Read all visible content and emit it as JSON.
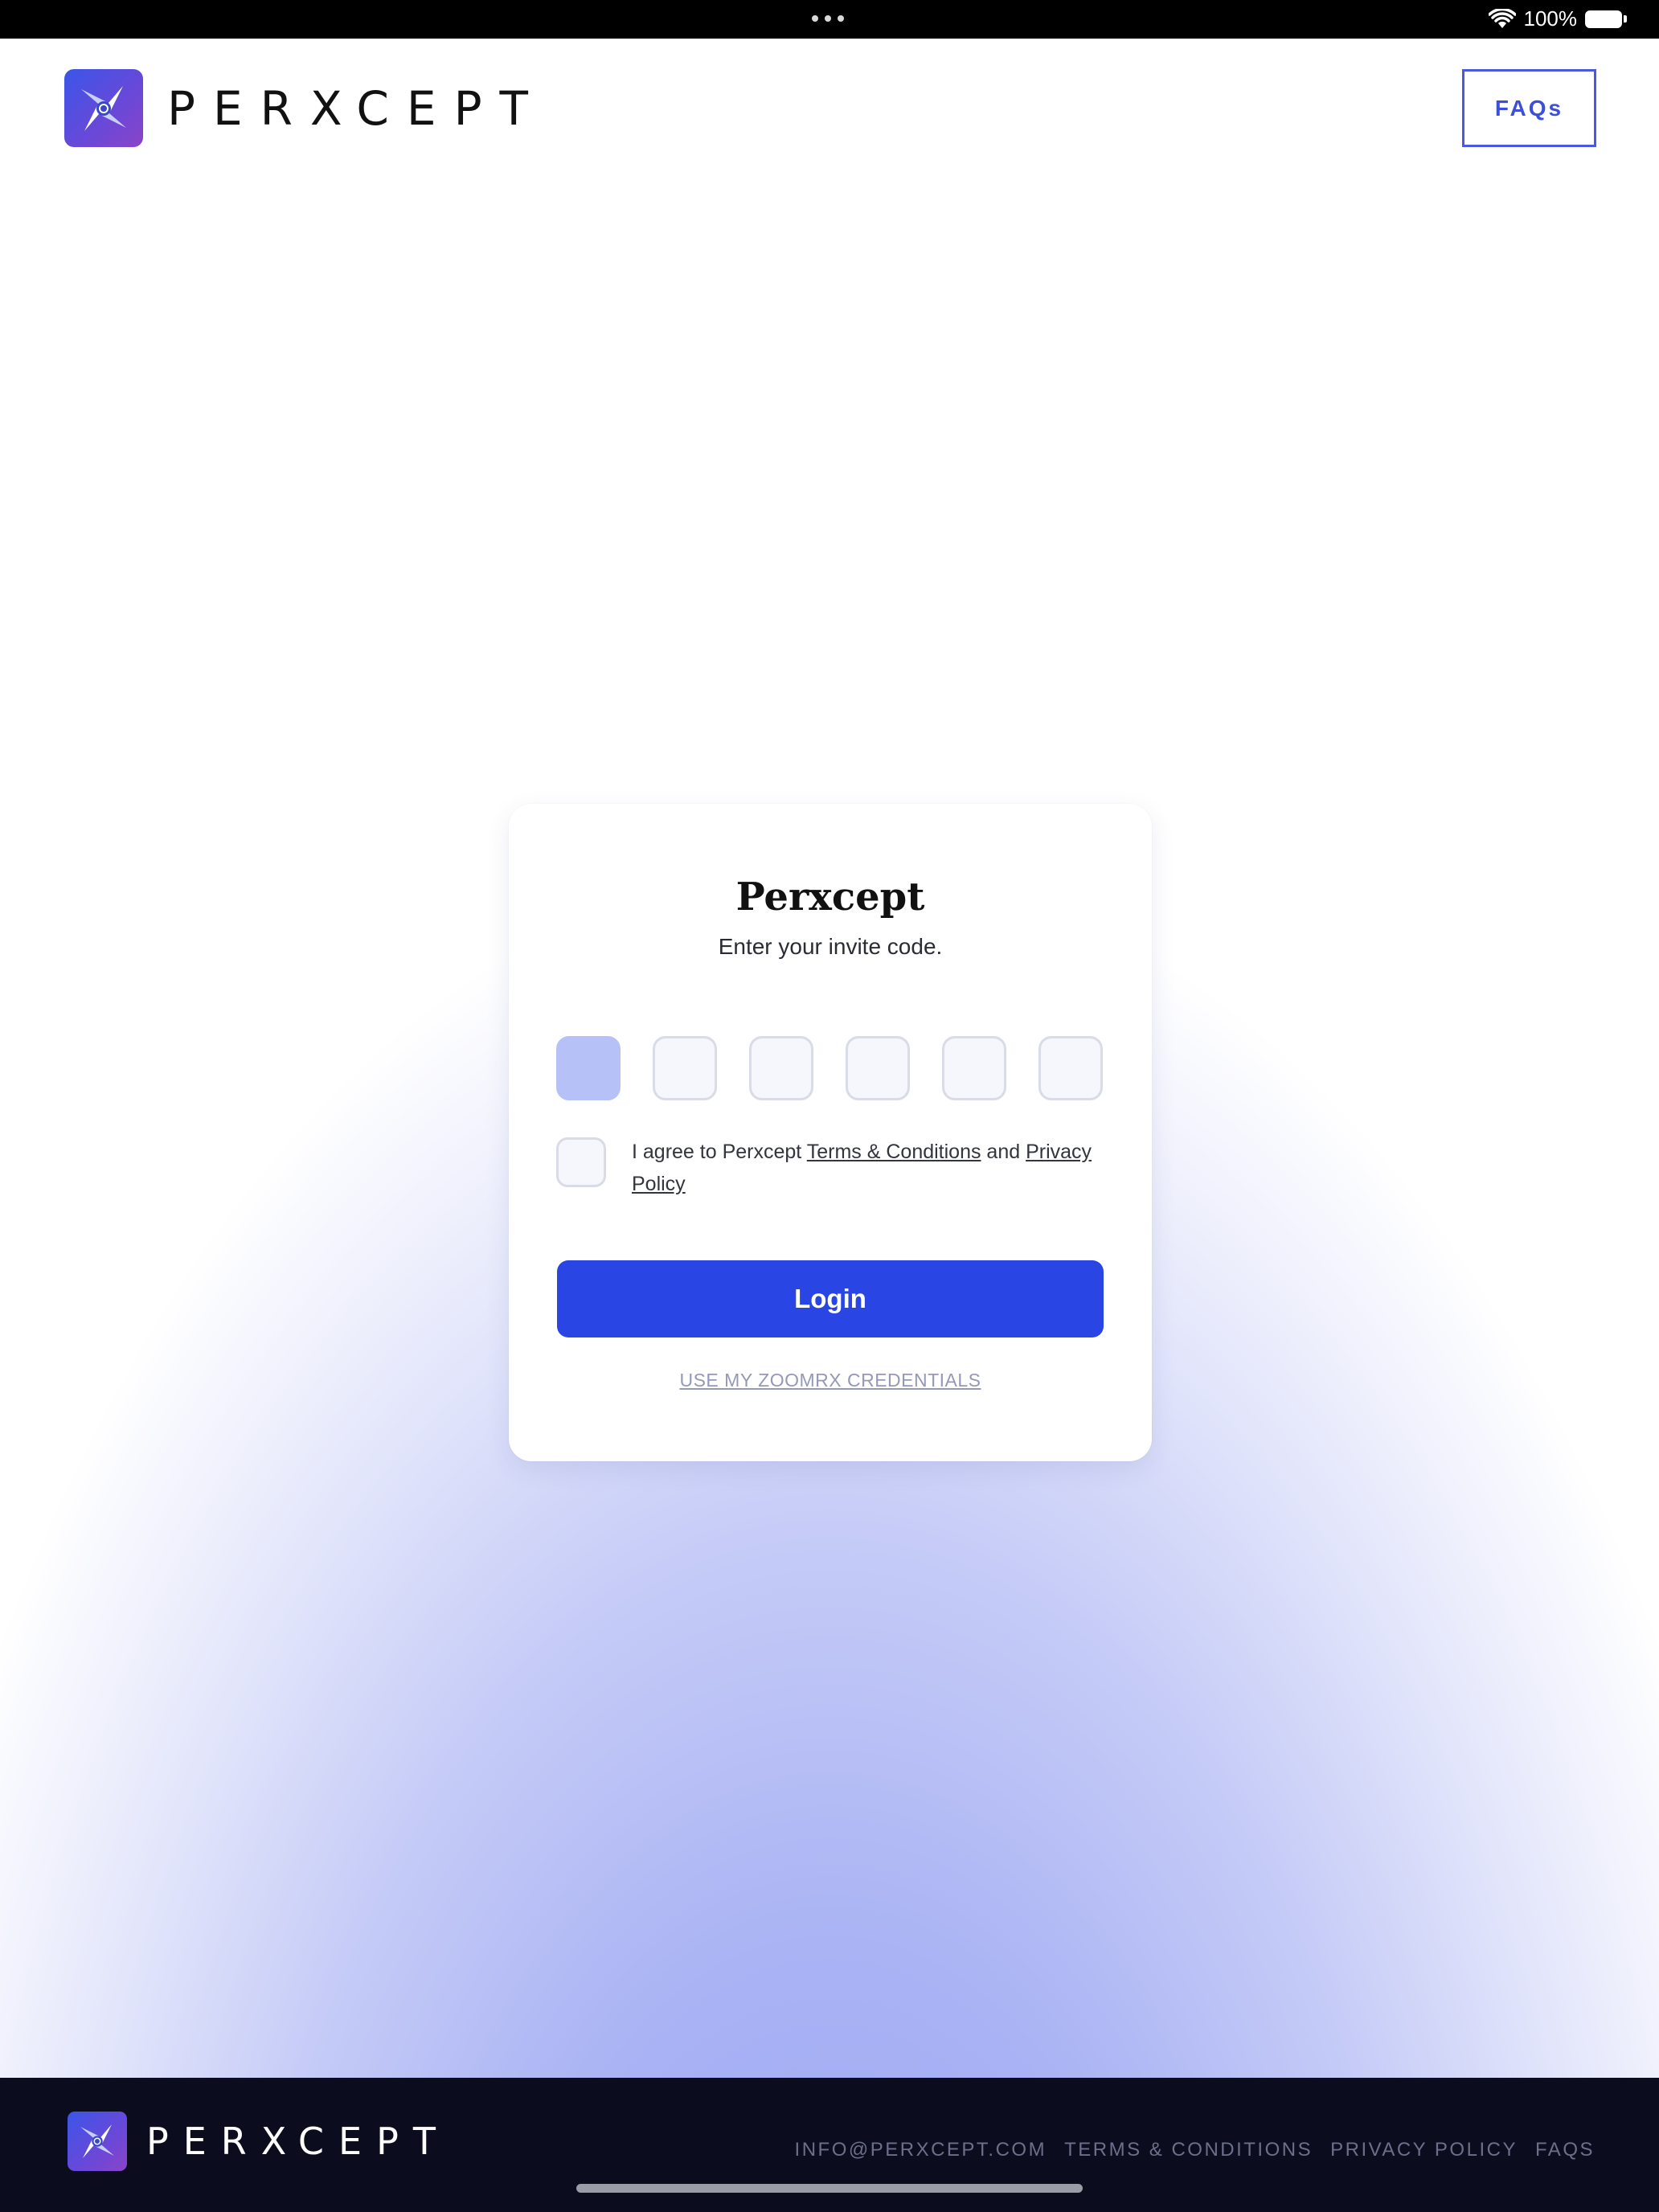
{
  "status_bar": {
    "dots_icon": "more-dots-icon",
    "battery_text": "100%"
  },
  "header": {
    "brand_wordmark": "PERXCEPT",
    "faq_label": "FAQs"
  },
  "login_card": {
    "title": "Perxcept",
    "subtitle": "Enter your invite code.",
    "code_boxes": [
      "",
      "",
      "",
      "",
      "",
      ""
    ],
    "agree_prefix": "I agree to Perxcept ",
    "terms_link": "Terms & Conditions",
    "agree_and": " and ",
    "privacy_link": "Privacy Policy",
    "login_label": "Login",
    "alt_login_label": "USE MY ZOOMRX CREDENTIALS"
  },
  "footer": {
    "brand_wordmark": "PERXCEPT",
    "links": {
      "email": "INFO@PERXCEPT.COM",
      "terms": "TERMS & CONDITIONS",
      "privacy": "PRIVACY POLICY",
      "faqs": "FAQS"
    }
  },
  "colors": {
    "accent": "#2946e5",
    "footer_bg": "#0b0d1e",
    "active_code_box": "#b6c1f7"
  }
}
